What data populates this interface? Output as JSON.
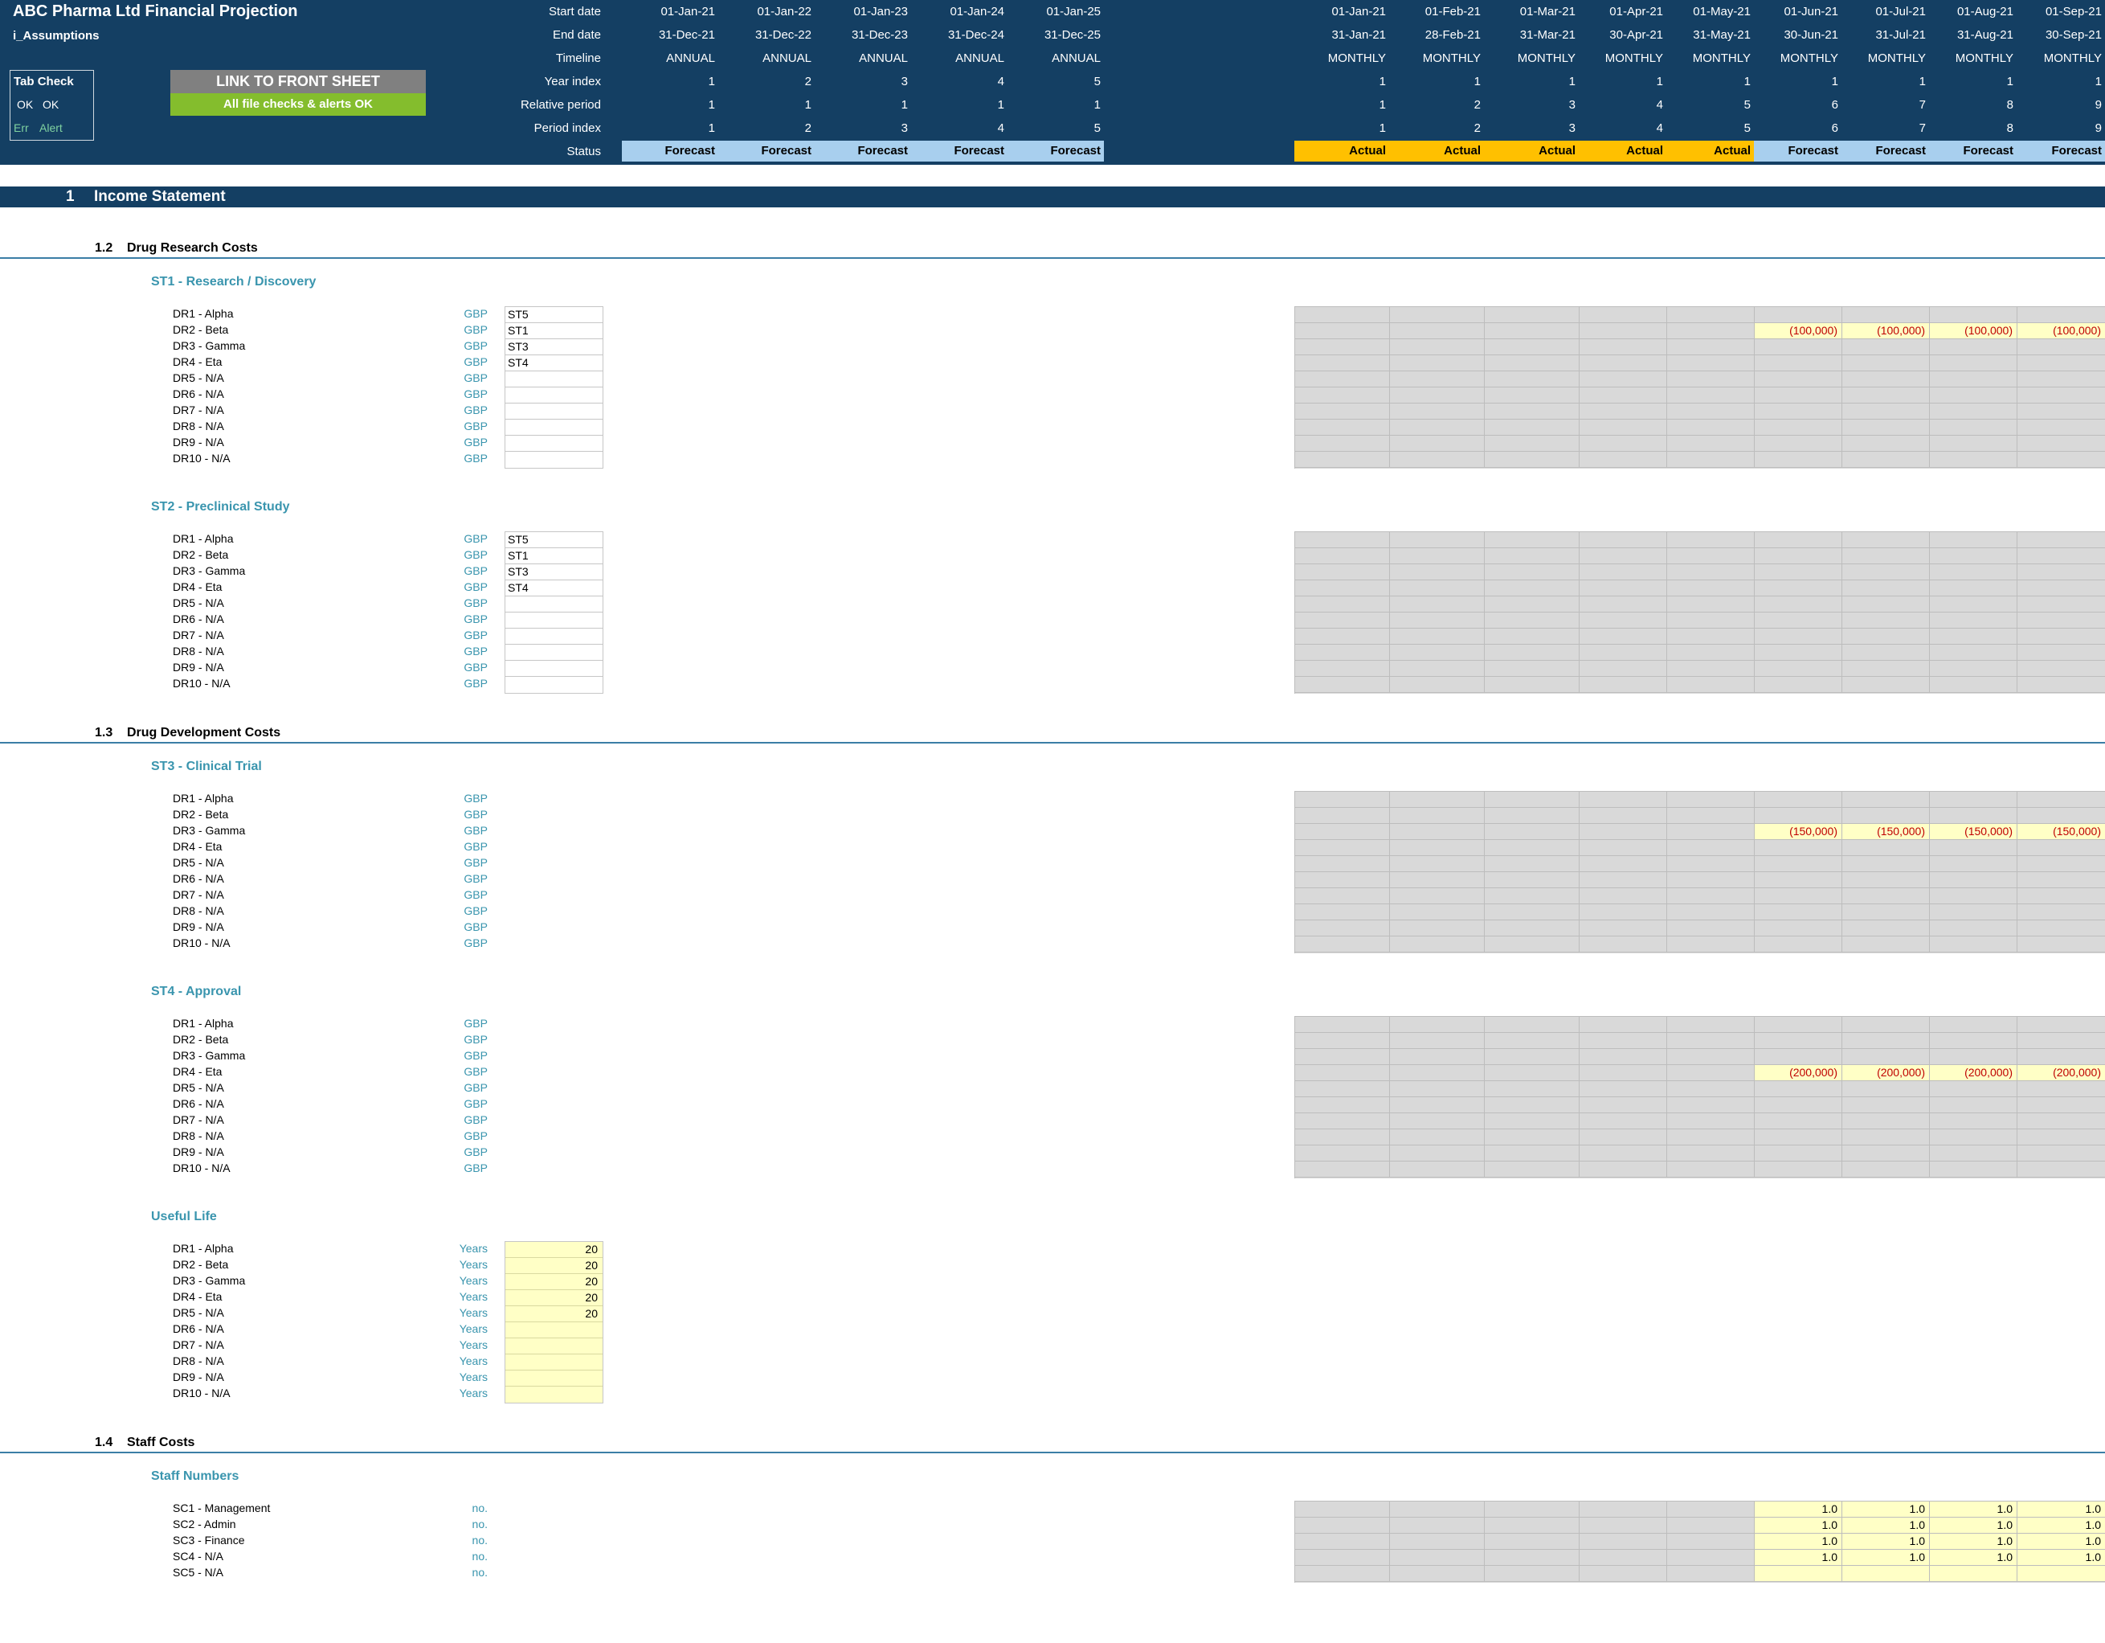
{
  "header": {
    "title": "ABC Pharma Ltd Financial Projection",
    "sheet": "i_Assumptions",
    "row_labels": [
      "Start date",
      "End date",
      "Timeline",
      "Year index",
      "Relative period",
      "Period index",
      "Status"
    ],
    "annual": [
      {
        "start": "01-Jan-21",
        "end": "31-Dec-21",
        "timeline": "ANNUAL",
        "year": "1",
        "relative": "1",
        "period": "1",
        "status": "Forecast"
      },
      {
        "start": "01-Jan-22",
        "end": "31-Dec-22",
        "timeline": "ANNUAL",
        "year": "2",
        "relative": "1",
        "period": "2",
        "status": "Forecast"
      },
      {
        "start": "01-Jan-23",
        "end": "31-Dec-23",
        "timeline": "ANNUAL",
        "year": "3",
        "relative": "1",
        "period": "3",
        "status": "Forecast"
      },
      {
        "start": "01-Jan-24",
        "end": "31-Dec-24",
        "timeline": "ANNUAL",
        "year": "4",
        "relative": "1",
        "period": "4",
        "status": "Forecast"
      },
      {
        "start": "01-Jan-25",
        "end": "31-Dec-25",
        "timeline": "ANNUAL",
        "year": "5",
        "relative": "1",
        "period": "5",
        "status": "Forecast"
      }
    ],
    "monthly": [
      {
        "start": "01-Jan-21",
        "end": "31-Jan-21",
        "timeline": "MONTHLY",
        "year": "1",
        "relative": "1",
        "period": "1",
        "status": "Actual"
      },
      {
        "start": "01-Feb-21",
        "end": "28-Feb-21",
        "timeline": "MONTHLY",
        "year": "1",
        "relative": "2",
        "period": "2",
        "status": "Actual"
      },
      {
        "start": "01-Mar-21",
        "end": "31-Mar-21",
        "timeline": "MONTHLY",
        "year": "1",
        "relative": "3",
        "period": "3",
        "status": "Actual"
      },
      {
        "start": "01-Apr-21",
        "end": "30-Apr-21",
        "timeline": "MONTHLY",
        "year": "1",
        "relative": "4",
        "period": "4",
        "status": "Actual"
      },
      {
        "start": "01-May-21",
        "end": "31-May-21",
        "timeline": "MONTHLY",
        "year": "1",
        "relative": "5",
        "period": "5",
        "status": "Actual"
      },
      {
        "start": "01-Jun-21",
        "end": "30-Jun-21",
        "timeline": "MONTHLY",
        "year": "1",
        "relative": "6",
        "period": "6",
        "status": "Forecast"
      },
      {
        "start": "01-Jul-21",
        "end": "31-Jul-21",
        "timeline": "MONTHLY",
        "year": "1",
        "relative": "7",
        "period": "7",
        "status": "Forecast"
      },
      {
        "start": "01-Aug-21",
        "end": "31-Aug-21",
        "timeline": "MONTHLY",
        "year": "1",
        "relative": "8",
        "period": "8",
        "status": "Forecast"
      },
      {
        "start": "01-Sep-21",
        "end": "30-Sep-21",
        "timeline": "MONTHLY",
        "year": "1",
        "relative": "9",
        "period": "9",
        "status": "Forecast"
      }
    ]
  },
  "tab_check": {
    "title": "Tab Check",
    "ok1": "OK",
    "ok2": "OK",
    "err": "Err",
    "alert": "Alert"
  },
  "buttons": {
    "link": "LINK TO FRONT SHEET",
    "checks": "All file checks & alerts OK"
  },
  "section": {
    "number": "1",
    "title": "Income Statement"
  },
  "subsections": [
    {
      "number": "1.2",
      "title": "Drug Research Costs"
    },
    {
      "number": "1.3",
      "title": "Drug Development Costs"
    },
    {
      "number": "1.4",
      "title": "Staff Costs"
    }
  ],
  "drug_labels": [
    "DR1 - Alpha",
    "DR2 - Beta",
    "DR3 - Gamma",
    "DR4 - Eta",
    "DR5 - N/A",
    "DR6 - N/A",
    "DR7 - N/A",
    "DR8 - N/A",
    "DR9 - N/A",
    "DR10 - N/A"
  ],
  "groups": [
    {
      "title": "ST1 - Research / Discovery",
      "unit": "GBP",
      "inputs": [
        "ST5",
        "ST1",
        "ST3",
        "ST4",
        "",
        "",
        "",
        "",
        "",
        ""
      ],
      "values": [
        [],
        [
          "(100,000)",
          "(100,000)",
          "(100,000)",
          "(100,000)"
        ],
        [],
        [],
        [],
        [],
        [],
        [],
        [],
        []
      ]
    },
    {
      "title": "ST2 - Preclinical Study",
      "unit": "GBP",
      "inputs": [
        "ST5",
        "ST1",
        "ST3",
        "ST4",
        "",
        "",
        "",
        "",
        "",
        ""
      ],
      "values": [
        [],
        [],
        [],
        [],
        [],
        [],
        [],
        [],
        [],
        []
      ]
    },
    {
      "title": "ST3 - Clinical Trial",
      "unit": "GBP",
      "values": [
        [],
        [],
        [
          "(150,000)",
          "(150,000)",
          "(150,000)",
          "(150,000)"
        ],
        [],
        [],
        [],
        [],
        [],
        [],
        []
      ]
    },
    {
      "title": "ST4 - Approval",
      "unit": "GBP",
      "values": [
        [],
        [],
        [],
        [
          "(200,000)",
          "(200,000)",
          "(200,000)",
          "(200,000)"
        ],
        [],
        [],
        [],
        [],
        [],
        []
      ]
    },
    {
      "title": "Useful Life",
      "unit": "Years",
      "inputs": [
        "20",
        "20",
        "20",
        "20",
        "20",
        "",
        "",
        "",
        "",
        ""
      ]
    }
  ],
  "staff": {
    "title": "Staff Numbers",
    "unit": "no.",
    "labels": [
      "SC1 - Management",
      "SC2 - Admin",
      "SC3 - Finance",
      "SC4 - N/A",
      "SC5 - N/A"
    ],
    "values": [
      [
        "1.0",
        "1.0",
        "1.0",
        "1.0"
      ],
      [
        "1.0",
        "1.0",
        "1.0",
        "1.0"
      ],
      [
        "1.0",
        "1.0",
        "1.0",
        "1.0"
      ],
      [
        "1.0",
        "1.0",
        "1.0",
        "1.0"
      ],
      [
        "",
        "",
        "",
        ""
      ]
    ]
  },
  "colors": {
    "header": "#143f63",
    "forecast": "#a8cfee",
    "actual": "#ffc000",
    "input": "#ffffc6",
    "accent": "#3a95ae",
    "negative": "#c00000",
    "ok_button": "#84bd2d",
    "link_button": "#808080"
  }
}
